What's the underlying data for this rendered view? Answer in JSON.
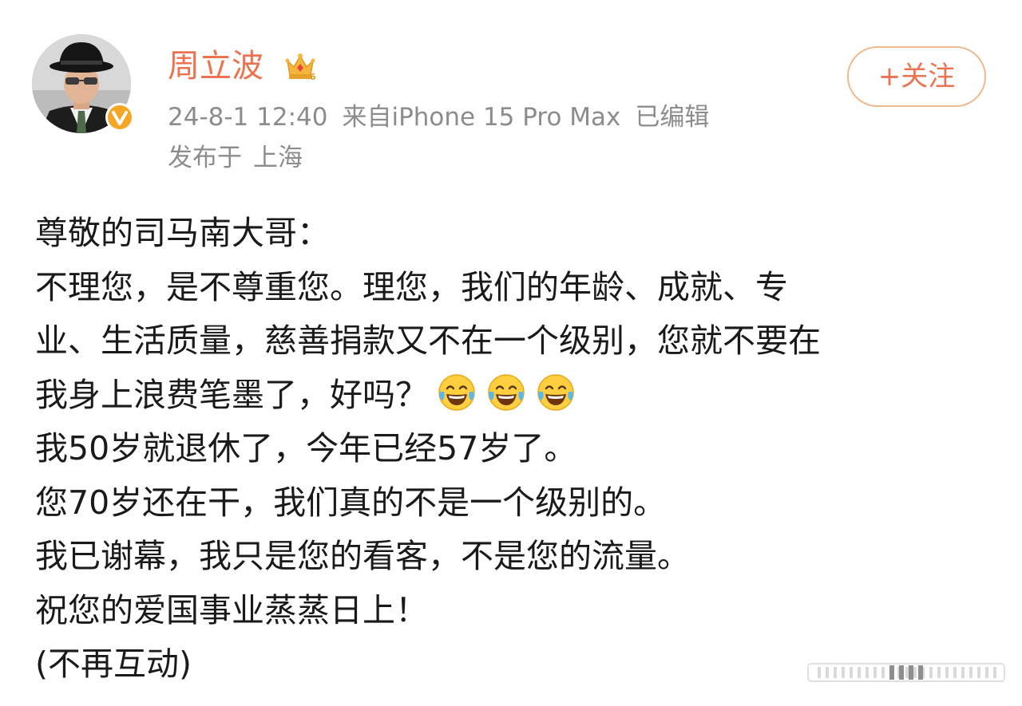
{
  "post": {
    "author": {
      "name": "周立波",
      "crown_badge_icon": "crown-icon",
      "verified_badge_icon": "verified-icon",
      "verified_color": "#f5a623"
    },
    "meta": {
      "timestamp": "24-8-1 12:40",
      "source": "来自iPhone 15 Pro Max",
      "edited": "已编辑",
      "location_label": "发布于",
      "location": "上海"
    },
    "follow_label": "+关注",
    "body_lines": [
      "尊敬的司马南大哥：",
      "不理您，是不尊重您。理您，我们的年龄、成就、专",
      "业、生活质量，慈善捐款又不在一个级别，您就不要在",
      "我身上浪费笔墨了，好吗？",
      "我50岁就退休了，今年已经57岁了。",
      "您70岁还在干，我们真的不是一个级别的。",
      "我已谢幕，我只是您的看客，不是您的流量。",
      "祝您的爱国事业蒸蒸日上！",
      "(不再互动)"
    ],
    "emojis": [
      "laughing-tears-icon",
      "laughing-tears-icon",
      "laughing-tears-icon"
    ]
  },
  "colors": {
    "accent": "#eb7350",
    "follow_border": "#f0b98d",
    "meta_text": "#8c8c8c",
    "body_text": "#1a1a1a"
  }
}
